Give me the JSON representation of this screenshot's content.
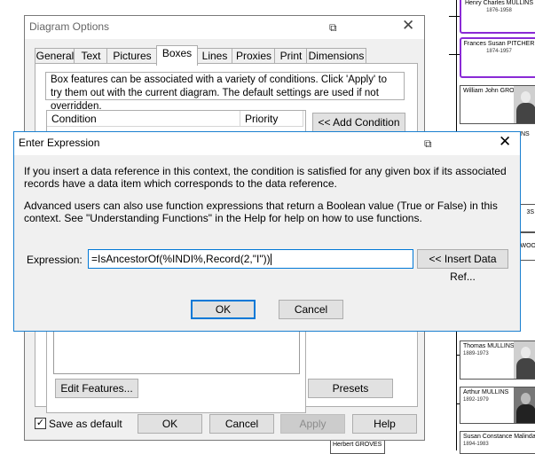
{
  "diagram": {
    "people": [
      {
        "name": "Henry Charles MULLINS",
        "dates": "1876-1958"
      },
      {
        "name": "Frances Susan PITCHER",
        "dates": "1874-1957"
      },
      {
        "name": "William John GROVES",
        "dates": ""
      },
      {
        "name": "Thomas MULLINS",
        "dates": "1889-1973"
      },
      {
        "name": "Arthur MULLINS",
        "dates": "1892-1979"
      },
      {
        "name": "Susan Constance Malinda L",
        "dates": "1894-1983"
      },
      {
        "name": "Herbert GROVES",
        "dates": ""
      }
    ],
    "fragments": [
      "NS",
      "3S",
      "WOO"
    ],
    "colors": {
      "selection": "#8a2ad6"
    }
  },
  "options_dialog": {
    "title": "Diagram Options",
    "tabs": [
      "General",
      "Text",
      "Pictures",
      "Boxes",
      "Lines",
      "Proxies",
      "Print",
      "Dimensions"
    ],
    "active_tab": "Boxes",
    "description": "Box features can be associated with a variety of conditions.  Click 'Apply' to try them out with the current diagram.  The default settings are used if not overridden.",
    "grid_headers": [
      "Condition",
      "Priority"
    ],
    "add_condition_label": "<< Add Condition",
    "edit_features_label": "Edit Features...",
    "presets_label": "Presets",
    "save_default_label": "Save as default",
    "save_default_checked": true,
    "ok_label": "OK",
    "cancel_label": "Cancel",
    "apply_label": "Apply",
    "help_label": "Help"
  },
  "expression_dialog": {
    "title": "Enter Expression",
    "paragraph1": "If you insert a data reference in this context, the condition is satisfied for any given box if its associated records have a data item which corresponds to the data reference.",
    "paragraph2": "Advanced users can also use function expressions that return a Boolean value (True or False) in this context. See \"Understanding Functions\" in the Help for help on how to use functions.",
    "expression_label": "Expression:",
    "expression_value": "=IsAncestorOf(%INDI%,Record(2,\"I\"))",
    "insert_data_ref_label": "<< Insert Data Ref...",
    "ok_label": "OK",
    "cancel_label": "Cancel",
    "accent_color": "#0078d7"
  }
}
